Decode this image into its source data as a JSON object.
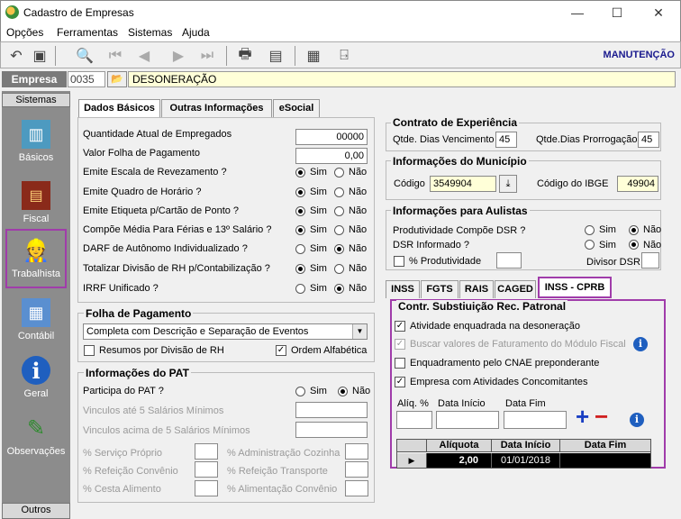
{
  "window": {
    "title": "Cadastro de Empresas",
    "minimize": "—",
    "maximize": "☐",
    "close": "✕"
  },
  "menu": [
    "Opções",
    "Ferramentas",
    "Sistemas",
    "Ajuda"
  ],
  "toolbar": {
    "mode": "MANUTENÇÃO"
  },
  "empresa": {
    "label": "Empresa",
    "code": "0035",
    "name": "DESONERAÇÃO"
  },
  "sidebar": {
    "header": "Sistemas",
    "footer": "Outros",
    "items": [
      {
        "label": "Básicos",
        "icon": "notebook-icon"
      },
      {
        "label": "Fiscal",
        "icon": "book-icon"
      },
      {
        "label": "Trabalhista",
        "icon": "worker-icon"
      },
      {
        "label": "Contábil",
        "icon": "calculator-icon"
      },
      {
        "label": "Geral",
        "icon": "info-icon"
      },
      {
        "label": "Observações",
        "icon": "pencil-icon"
      }
    ]
  },
  "tabs": [
    "Dados Básicos",
    "Outras Informações",
    "eSocial"
  ],
  "dados": {
    "qtd_empregados_label": "Quantidade Atual de Empregados",
    "qtd_empregados": "00000",
    "valor_folha_label": "Valor Folha de Pagamento",
    "valor_folha": "0,00",
    "sim": "Sim",
    "nao": "Não",
    "questions": [
      {
        "label": "Emite Escala de Revezamento ?",
        "value": "Sim"
      },
      {
        "label": "Emite Quadro de Horário ?",
        "value": "Sim"
      },
      {
        "label": "Emite Etiqueta p/Cartão de Ponto ?",
        "value": "Sim"
      },
      {
        "label": "Compõe Média Para Férias e 13º Salário ?",
        "value": "Sim"
      },
      {
        "label": "DARF de Autônomo Individualizado ?",
        "value": "Não"
      },
      {
        "label": "Totalizar Divisão de RH p/Contabilização ?",
        "value": "Sim"
      },
      {
        "label": "IRRF Unificado ?",
        "value": "Não"
      }
    ]
  },
  "folha": {
    "title": "Folha de Pagamento",
    "select_value": "Completa com Descrição e Separação de Eventos",
    "resumos": "Resumos por Divisão de RH",
    "ordem": "Ordem Alfabética"
  },
  "pat": {
    "title": "Informações do PAT",
    "participa": "Participa do PAT ?",
    "vinc_ate": "Vinculos até 5 Salários Mínimos",
    "vinc_acima": "Vinculos acima de 5 Salários Mínimos",
    "serv_proprio": "% Serviço Próprio",
    "ref_convenio": "% Refeição Convênio",
    "cesta": "% Cesta Alimento",
    "adm_cozinha": "% Administração Cozinha",
    "ref_transporte": "% Refeição Transporte",
    "alim_convenio": "% Alimentação Convênio"
  },
  "contrato": {
    "title": "Contrato de Experiência",
    "venc_label": "Qtde. Dias Vencimento",
    "venc": "45",
    "prorr_label": "Qtde.Dias Prorrogação",
    "prorr": "45"
  },
  "municipio": {
    "title": "Informações do Município",
    "codigo_label": "Código",
    "codigo": "3549904",
    "ibge_label": "Código do IBGE",
    "ibge": "49904"
  },
  "aulistas": {
    "title": "Informações para Aulistas",
    "prod_dsr": "Produtividade Compõe DSR ?",
    "dsr_inf": "DSR Informado ?",
    "perc_prod": "% Produtividade",
    "divisor": "Divisor DSR"
  },
  "subtabs": [
    "INSS",
    "FGTS",
    "RAIS",
    "CAGED",
    "INSS - CPRB"
  ],
  "cprb": {
    "title": "Contr. Substiuição Rec. Patronal",
    "atividade": "Atividade enquadrada na desoneração",
    "buscar": "Buscar valores de Faturamento do Módulo Fiscal",
    "cnae": "Enquadramento pelo CNAE preponderante",
    "concomitantes": "Empresa com Atividades Concomitantes",
    "aliq_label": "Alíq. %",
    "inicio_label": "Data Início",
    "fim_label": "Data Fim",
    "add": "+",
    "remove": "−",
    "grid_headers": [
      "Alíquota",
      "Data Início",
      "Data Fim"
    ],
    "grid_rows": [
      {
        "aliquota": "2,00",
        "inicio": "01/01/2018",
        "fim": ""
      }
    ]
  }
}
